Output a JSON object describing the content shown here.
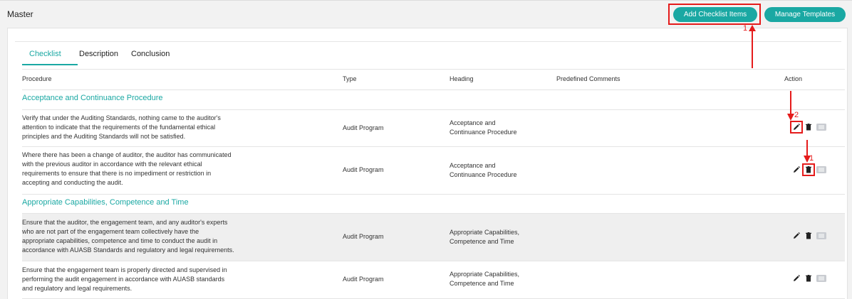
{
  "page": {
    "title": "Master"
  },
  "actions": {
    "add_checklist_items": "Add Checklist Items",
    "manage_templates": "Manage Templates"
  },
  "tabs": [
    {
      "label": "Checklist",
      "active": true
    },
    {
      "label": "Description",
      "active": false
    },
    {
      "label": "Conclusion",
      "active": false
    }
  ],
  "table": {
    "columns": [
      "Procedure",
      "Type",
      "Heading",
      "Predefined Comments",
      "Action"
    ],
    "groups": [
      {
        "title": "Acceptance and Continuance Procedure",
        "rows": [
          {
            "procedure": [
              "Verify that under the Auditing Standards, nothing came to the auditor's",
              "attention to indicate that the requirements of the fundamental ethical",
              "principles and the Auditing Standards will not be satisfied."
            ],
            "type": "Audit Program",
            "heading": [
              "Acceptance and",
              "Continuance Procedure"
            ]
          },
          {
            "procedure": [
              "Where there has been a change of auditor, the auditor has communicated",
              "with the previous auditor in accordance with the relevant ethical",
              "requirements to ensure that there is no impediment or restriction in",
              "accepting and conducting the audit."
            ],
            "type": "Audit Program",
            "heading": [
              "Acceptance and",
              "Continuance Procedure"
            ]
          }
        ]
      },
      {
        "title": "Appropriate Capabilities, Competence and Time",
        "rows": [
          {
            "procedure": [
              "Ensure that the auditor, the engagement team, and any auditor's experts",
              "who are not part of the engagement team collectively have the",
              "appropriate capabilities, competence and time to conduct the audit in",
              "accordance with AUASB Standards and regulatory and legal requirements."
            ],
            "type": "Audit Program",
            "heading": [
              "Appropriate Capabilities,",
              "Competence and Time"
            ]
          },
          {
            "procedure": [
              "Ensure that the engagement team is properly directed and supervised in",
              "performing the audit engagement in accordance with AUASB standards",
              "and regulatory and legal requirements."
            ],
            "type": "Audit Program",
            "heading": [
              "Appropriate Capabilities,",
              "Competence and Time"
            ]
          }
        ]
      }
    ]
  },
  "annotations": {
    "top": "1",
    "edit": "2",
    "delete": "1"
  },
  "icons": {
    "edit": "pencil-icon",
    "delete": "trash-icon",
    "details": "list-icon"
  },
  "colors": {
    "accent": "#1aa8a3",
    "annotation": "#e51b1b"
  }
}
